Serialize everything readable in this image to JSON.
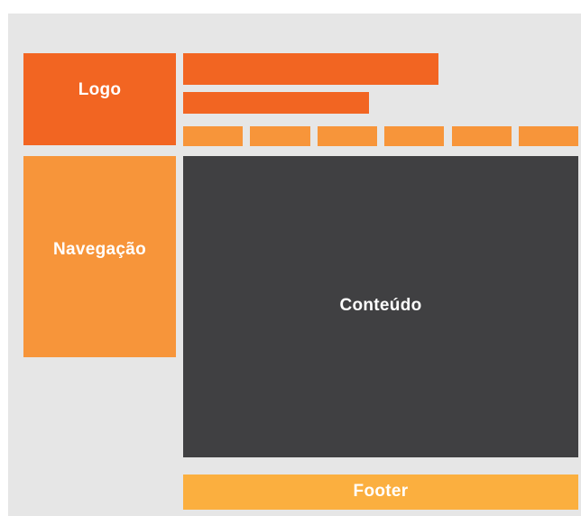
{
  "blocks": {
    "logo": "Logo",
    "navigation": "Navegação",
    "content": "Conteúdo",
    "footer": "Footer"
  },
  "colors": {
    "background": "#e6e6e6",
    "logo": "#f26522",
    "header_bars": "#f26522",
    "navigation": "#f7953a",
    "menu_tabs": "#f7953a",
    "content": "#404042",
    "footer": "#fbaf3f"
  }
}
